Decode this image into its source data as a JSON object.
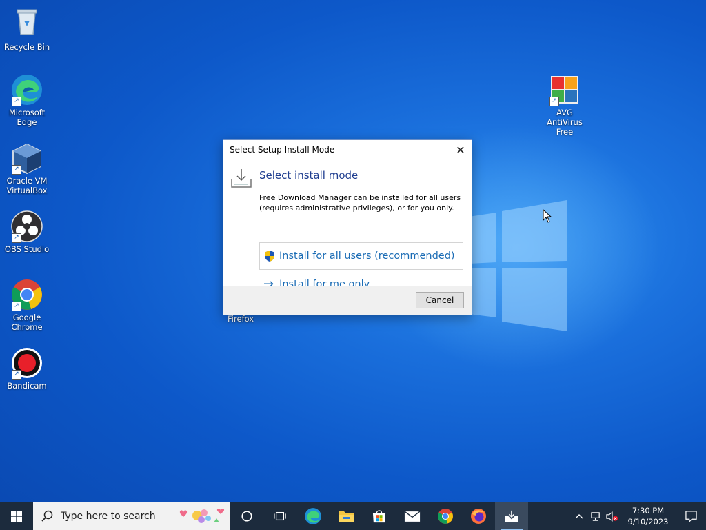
{
  "desktop": {
    "icons": [
      {
        "label": "Recycle Bin"
      },
      {
        "label": "Microsoft Edge"
      },
      {
        "label": "Oracle VM VirtualBox"
      },
      {
        "label": "OBS Studio"
      },
      {
        "label": "Google Chrome"
      },
      {
        "label": "Bandicam"
      },
      {
        "label": "AVG AntiVirus Free"
      },
      {
        "label": "Firefox"
      }
    ]
  },
  "dialog": {
    "title": "Select Setup Install Mode",
    "close_glyph": "✕",
    "heading": "Select install mode",
    "description": "Free Download Manager can be installed for all users (requires administrative privileges), or for you only.",
    "option_all_users": "Install for all users (recommended)",
    "option_me_only": "Install for me only",
    "cancel_label": "Cancel"
  },
  "taskbar": {
    "search_placeholder": "Type here to search",
    "apps": [
      "cortana-icon",
      "task-view-icon",
      "edge-icon",
      "file-explorer-icon",
      "store-icon",
      "mail-icon",
      "chrome-icon",
      "firefox-icon",
      "fdm-icon"
    ],
    "time": "7:30 PM",
    "date": "9/10/2023"
  },
  "colors": {
    "accent": "#1b6cb5",
    "heading": "#1e3d8f",
    "taskbar": "#1c2b3d"
  }
}
